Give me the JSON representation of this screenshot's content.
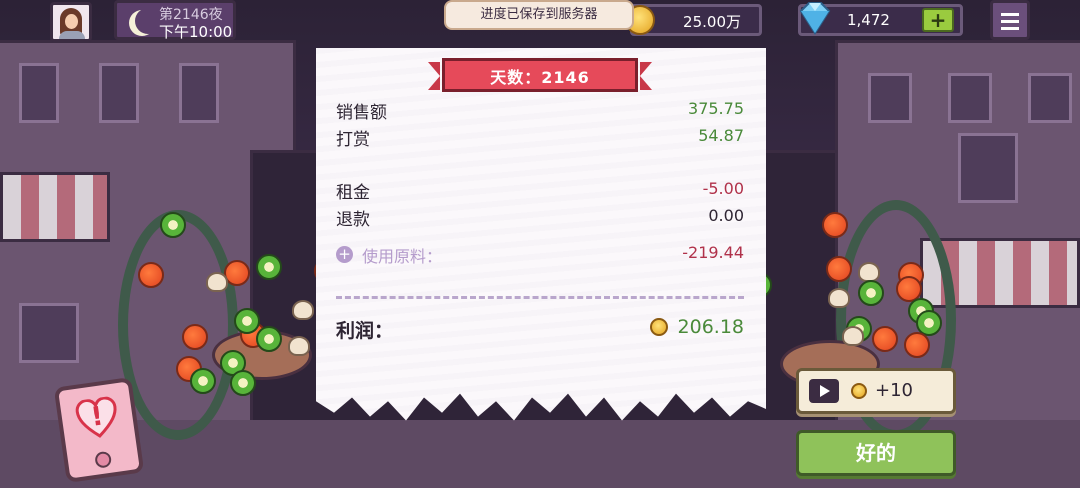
{
  "hud": {
    "day_label": "第2146夜",
    "time": "下午10:00",
    "save_toast": "进度已保存到服务器",
    "coins": "25.00万",
    "gems": "1,472",
    "gem_add_label": "+",
    "icons": [
      "avatar",
      "moon-icon",
      "coin-icon",
      "diamond-icon",
      "plus-icon",
      "menu-icon"
    ]
  },
  "receipt": {
    "title": "天数：2146",
    "rows": [
      {
        "label": "销售额",
        "value": "375.75"
      },
      {
        "label": "打赏",
        "value": "54.87"
      },
      {
        "label": "租金",
        "value": "-5.00"
      },
      {
        "label": "退款",
        "value": "0.00"
      }
    ],
    "ingredients": {
      "label": "使用原料：",
      "value": "-219.44"
    },
    "profit": {
      "label": "利润：",
      "value": "206.18"
    }
  },
  "buttons": {
    "ad_reward": "+10",
    "ok": "好的"
  },
  "colors": {
    "positive": "#4a8a3a",
    "negative": "#b0314a",
    "ribbon": "#e64a5a",
    "ok_button": "#8fc25a"
  }
}
